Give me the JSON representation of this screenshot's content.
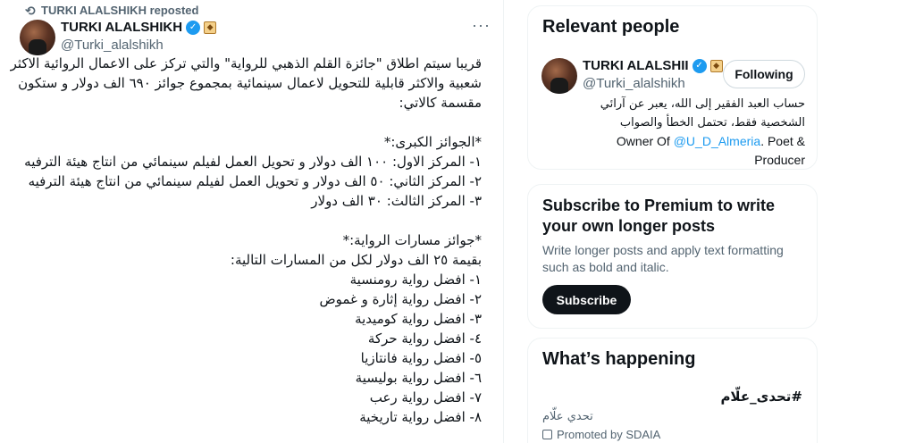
{
  "post": {
    "reposted_by": "TURKI ALALSHIKH reposted",
    "author_name": "TURKI ALALSHIKH",
    "author_handle": "@Turki_alalshikh",
    "more_icon": "more-dots-icon",
    "lines": [
      "قريبا سيتم اطلاق \"جائزة القلم الذهبي للرواية\" والتي تركز على الاعمال الروائية الاكثر",
      "شعبية والاكثر قابلية للتحويل لاعمال سينمائية بمجموع جوائز ٦٩٠ الف دولار و ستكون",
      "مقسمة كالاتي:",
      "",
      "*الجوائز الكبرى:*",
      "١- المركز الاول: ١٠٠ الف دولار و تحويل العمل لفيلم سينمائي من انتاج هيئة الترفيه",
      "٢- المركز الثاني: ٥٠ الف دولار و تحويل العمل لفيلم سينمائي من انتاج هيئة الترفيه",
      "٣- المركز الثالث: ٣٠ الف دولار",
      "",
      "*جوائز مسارات الرواية:*",
      "بقيمة ٢٥ الف دولار لكل من المسارات التالية:",
      "١- افضل رواية رومنسية",
      "٢- افضل رواية إثارة و غموض",
      "٣- افضل رواية كوميدية",
      "٤- افضل رواية حركة",
      "٥- افضل رواية فانتازيا",
      "٦- افضل رواية بوليسية",
      "٧- افضل رواية رعب",
      "٨- افضل رواية تاريخية"
    ]
  },
  "relevant": {
    "title": "Relevant people",
    "name": "TURKI ALALSHII",
    "handle": "@Turki_alalshikh",
    "follow_label": "Following",
    "bio_line1": "حساب العبد الفقير إلى الله، يعبر عن آرائي",
    "bio_line2": "الشخصية فقط، تحتمل الخطأ والصواب",
    "bio_owner_prefix": "Owner Of ",
    "bio_owner_link": "@U_D_Almeria",
    "bio_owner_suffix": ". Poet &",
    "bio_line4": "Producer"
  },
  "premium": {
    "title": "Subscribe to Premium to write your own longer posts",
    "description": "Write longer posts and apply text formatting such as bold and italic.",
    "button": "Subscribe"
  },
  "happening": {
    "title": "What’s happening",
    "trend_tag": "#تحدى_علّام",
    "trend_sub": "تحدي علّام",
    "promoted": "Promoted by SDAIA"
  },
  "colors": {
    "accent": "#1d9bf0",
    "text": "#0f1419",
    "muted": "#536471",
    "border": "#eff3f4"
  }
}
